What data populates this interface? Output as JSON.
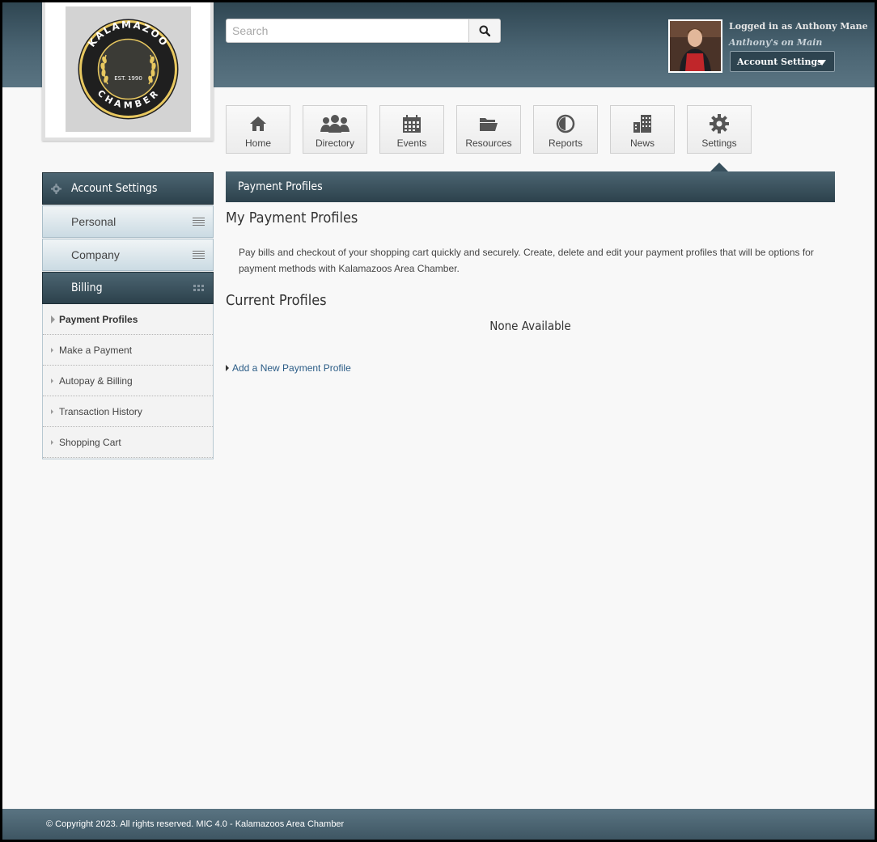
{
  "header": {
    "logo": {
      "org_name": "KALAMAZOO",
      "sub_name": "CHAMBER",
      "established": "EST. 1990"
    },
    "search": {
      "placeholder": "Search"
    },
    "user": {
      "logged_in_text": "Logged in as Anthony Mane",
      "business": "Anthony's on Main",
      "dropdown_label": "Account Settings"
    }
  },
  "nav": [
    {
      "label": "Home",
      "icon": "home-icon"
    },
    {
      "label": "Directory",
      "icon": "people-icon"
    },
    {
      "label": "Events",
      "icon": "calendar-icon"
    },
    {
      "label": "Resources",
      "icon": "folder-icon"
    },
    {
      "label": "Reports",
      "icon": "pie-chart-icon"
    },
    {
      "label": "News",
      "icon": "buildings-icon"
    },
    {
      "label": "Settings",
      "icon": "gear-icon",
      "active": true
    }
  ],
  "sidebar": {
    "title": "Account Settings",
    "sections": [
      {
        "label": "Personal"
      },
      {
        "label": "Company"
      },
      {
        "label": "Billing",
        "expanded": true
      }
    ],
    "billing_items": [
      {
        "label": "Payment Profiles",
        "active": true
      },
      {
        "label": "Make a Payment"
      },
      {
        "label": "Autopay & Billing"
      },
      {
        "label": "Transaction History"
      },
      {
        "label": "Shopping Cart"
      }
    ]
  },
  "main": {
    "panel_title": "Payment Profiles",
    "heading": "My Payment Profiles",
    "intro": "Pay bills and checkout of your shopping cart quickly and securely. Create, delete and edit your payment profiles that will be options for payment methods with Kalamazoos Area Chamber.",
    "current_heading": "Current Profiles",
    "empty_text": "None Available",
    "add_link": "Add a New Payment Profile"
  },
  "footer": {
    "text": "© Copyright 2023. All rights reserved. MIC 4.0 - Kalamazoos Area Chamber"
  },
  "colors": {
    "header_dark": "#2f4652",
    "accent_bar": "#38505d",
    "link": "#2b5c86",
    "logo_gold": "#e8c860"
  }
}
